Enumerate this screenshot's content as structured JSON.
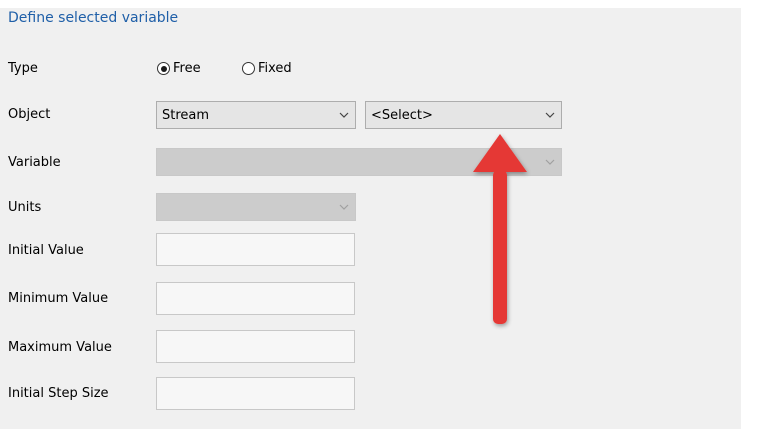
{
  "section": {
    "title": "Define selected variable"
  },
  "fields": {
    "type_label": "Type",
    "object_label": "Object",
    "variable_label": "Variable",
    "units_label": "Units",
    "initial_value_label": "Initial Value",
    "minimum_value_label": "Minimum Value",
    "maximum_value_label": "Maximum Value",
    "initial_step_size_label": "Initial Step Size"
  },
  "type_options": {
    "free": "Free",
    "fixed": "Fixed",
    "selected": "Free"
  },
  "object": {
    "type_value": "Stream",
    "instance_value": "<Select>"
  },
  "variable": {
    "value": ""
  },
  "units": {
    "value": ""
  },
  "inputs": {
    "initial_value": "",
    "minimum_value": "",
    "maximum_value": "",
    "initial_step_size": ""
  },
  "icons": {
    "dropdown": "chevron-down-icon",
    "annotation": "red-arrow-up-icon"
  },
  "colors": {
    "title": "#1f5fa8",
    "arrow": "#e53935",
    "panel": "#f0f0f0"
  }
}
